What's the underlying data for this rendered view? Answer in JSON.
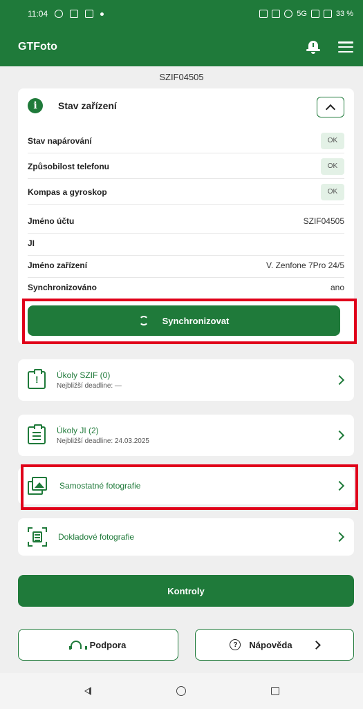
{
  "status_bar": {
    "time": "11:04",
    "battery": "33 %",
    "network": "5G"
  },
  "app": {
    "title": "GTFoto"
  },
  "device_id": "SZIF04505",
  "device_status": {
    "title": "Stav zařízení",
    "checks": [
      {
        "label": "Stav napárování",
        "status": "OK"
      },
      {
        "label": "Způsobilost telefonu",
        "status": "OK"
      },
      {
        "label": "Kompas a gyroskop",
        "status": "OK"
      }
    ],
    "info": [
      {
        "label": "Jméno účtu",
        "value": "SZIF04505"
      },
      {
        "label": "JI",
        "value": ""
      },
      {
        "label": "Jméno zařízení",
        "value": "V. Zenfone 7Pro 24/5"
      },
      {
        "label": "Synchronizováno",
        "value": "ano"
      }
    ],
    "sync_button": "Synchronizovat"
  },
  "nav_items": [
    {
      "label": "Úkoly SZIF (0)",
      "sub": "Nejbližší deadline: —"
    },
    {
      "label": "Úkoly JI (2)",
      "sub": "Nejbližší deadline: 24.03.2025"
    },
    {
      "label": "Samostatné fotografie",
      "sub": ""
    },
    {
      "label": "Dokladové fotografie",
      "sub": ""
    }
  ],
  "kontroly_button": "Kontroly",
  "support_button": "Podpora",
  "help_button": "Nápověda",
  "colors": {
    "primary": "#1f7a3a",
    "highlight": "#e0001a",
    "ok_badge_bg": "#e3f1e6"
  }
}
